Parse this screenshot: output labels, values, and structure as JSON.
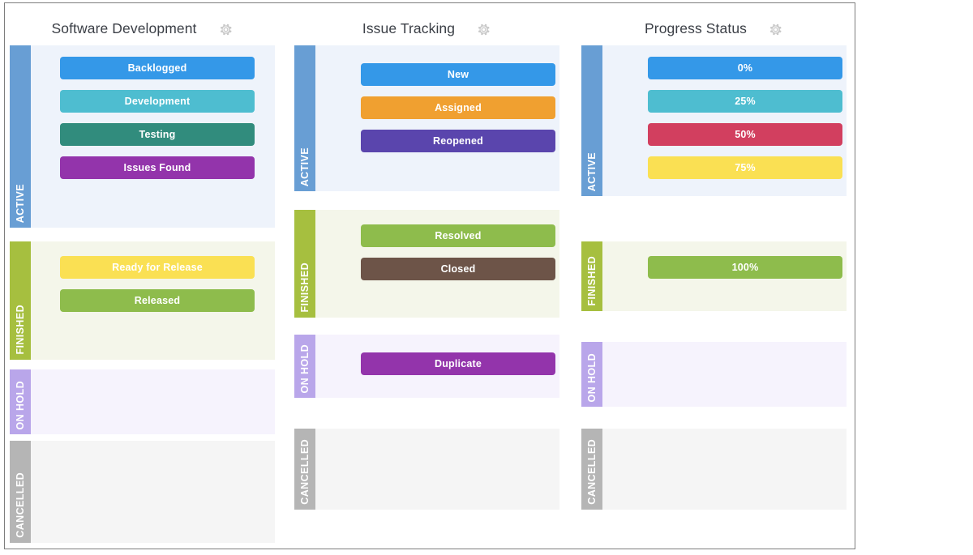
{
  "board": {
    "gear_icon": "gear-icon",
    "columns": [
      {
        "title": "Software Development",
        "settings_icon": "gear-icon",
        "lanes": [
          {
            "label": "ACTIVE",
            "key": "active",
            "tab_color": "#689ed4",
            "body_color": "#eef3fb",
            "cards": [
              {
                "label": "Backlogged",
                "color": "#3498e8"
              },
              {
                "label": "Development",
                "color": "#4ebdd0"
              },
              {
                "label": "Testing",
                "color": "#318c7d"
              },
              {
                "label": "Issues Found",
                "color": "#9334ab"
              }
            ]
          },
          {
            "label": "FINISHED",
            "key": "finished",
            "tab_color": "#a6bf3f",
            "body_color": "#f4f6ea",
            "cards": [
              {
                "label": "Ready for Release",
                "color": "#fae053"
              },
              {
                "label": "Released",
                "color": "#8ebc4c"
              }
            ]
          },
          {
            "label": "ON HOLD",
            "key": "onhold",
            "tab_color": "#b9a6ea",
            "body_color": "#f6f3fd",
            "cards": []
          },
          {
            "label": "CANCELLED",
            "key": "cancelled",
            "tab_color": "#b5b5b5",
            "body_color": "#f5f5f5",
            "cards": []
          }
        ]
      },
      {
        "title": "Issue Tracking",
        "settings_icon": "gear-icon",
        "lanes": [
          {
            "label": "ACTIVE",
            "key": "active",
            "tab_color": "#689ed4",
            "body_color": "#eef3fb",
            "cards": [
              {
                "label": "New",
                "color": "#3498e8"
              },
              {
                "label": "Assigned",
                "color": "#f0a030"
              },
              {
                "label": "Reopened",
                "color": "#5a45ad"
              }
            ]
          },
          {
            "label": "FINISHED",
            "key": "finished",
            "tab_color": "#a6bf3f",
            "body_color": "#f4f6ea",
            "cards": [
              {
                "label": "Resolved",
                "color": "#8ebc4c"
              },
              {
                "label": "Closed",
                "color": "#6d5448"
              }
            ]
          },
          {
            "label": "ON HOLD",
            "key": "onhold",
            "tab_color": "#b9a6ea",
            "body_color": "#f6f3fd",
            "cards": [
              {
                "label": "Duplicate",
                "color": "#9334ab"
              }
            ]
          },
          {
            "label": "CANCELLED",
            "key": "cancelled",
            "tab_color": "#b5b5b5",
            "body_color": "#f5f5f5",
            "cards": []
          }
        ]
      },
      {
        "title": "Progress Status",
        "settings_icon": "gear-icon",
        "lanes": [
          {
            "label": "ACTIVE",
            "key": "active",
            "tab_color": "#689ed4",
            "body_color": "#eef3fb",
            "cards": [
              {
                "label": "0%",
                "color": "#3498e8"
              },
              {
                "label": "25%",
                "color": "#4ebdd0"
              },
              {
                "label": "50%",
                "color": "#d23f5f"
              },
              {
                "label": "75%",
                "color": "#fae053"
              }
            ]
          },
          {
            "label": "FINISHED",
            "key": "finished",
            "tab_color": "#a6bf3f",
            "body_color": "#f4f6ea",
            "cards": [
              {
                "label": "100%",
                "color": "#8ebc4c"
              }
            ]
          },
          {
            "label": "ON HOLD",
            "key": "onhold",
            "tab_color": "#b9a6ea",
            "body_color": "#f6f3fd",
            "cards": []
          },
          {
            "label": "CANCELLED",
            "key": "cancelled",
            "tab_color": "#b5b5b5",
            "body_color": "#f5f5f5",
            "cards": []
          }
        ]
      }
    ]
  }
}
